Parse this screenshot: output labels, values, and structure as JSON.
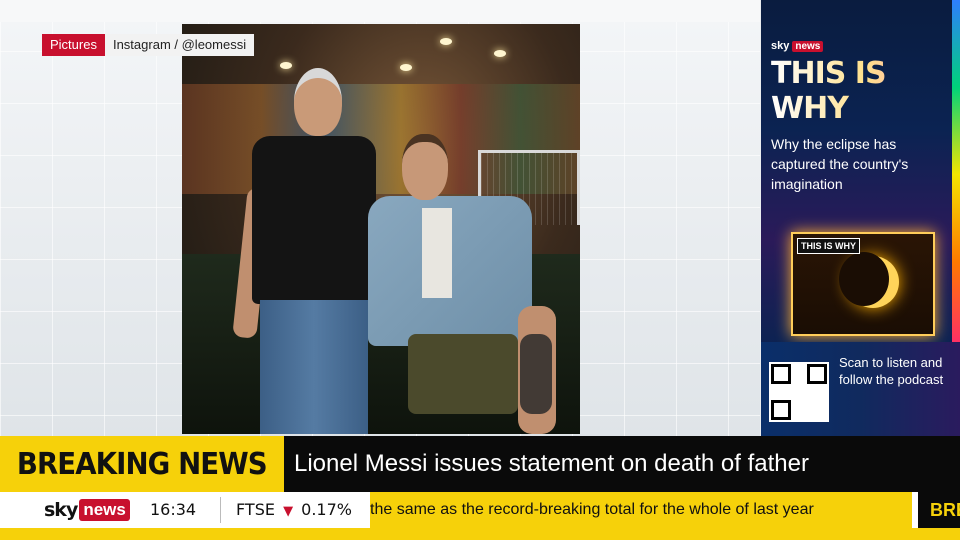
{
  "caption": {
    "tag": "Pictures",
    "source": "Instagram / @leomessi"
  },
  "promo": {
    "brand_sky": "sky",
    "brand_news": "news",
    "title": "THIS IS WHY",
    "description": "Why the eclipse has captured the country's imagination",
    "card_badge": "THIS IS WHY",
    "scan_text": "Scan to listen and follow the podcast"
  },
  "lower_third": {
    "label": "BREAKING NEWS",
    "headline": "Lionel Messi issues statement on death of father"
  },
  "ticker": {
    "logo_sky": "sky",
    "logo_news": "news",
    "time": "16:34",
    "market_name": "FTSE",
    "market_direction": "down",
    "market_change": "0.17%",
    "scrolling_text": "the same as the record-breaking total for the whole of last year",
    "next_item_fragment": "BRE"
  },
  "colors": {
    "brand_red": "#c8102e",
    "breaking_yellow": "#f6d10a",
    "panel_navy": "#0a1c3f"
  }
}
